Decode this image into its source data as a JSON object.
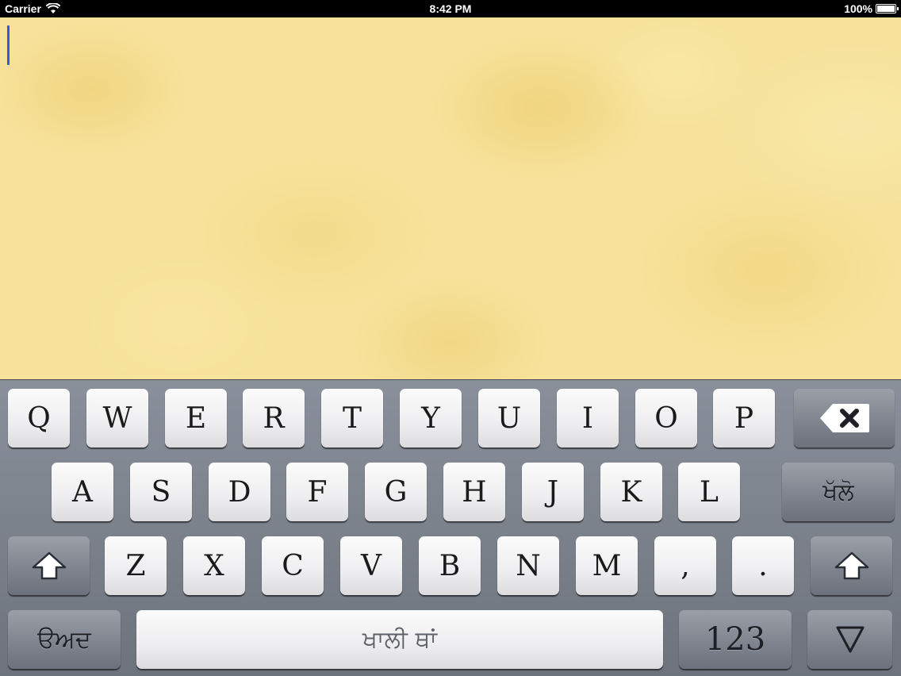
{
  "status_bar": {
    "carrier": "Carrier",
    "time": "8:42 PM",
    "battery": "100%"
  },
  "keyboard": {
    "row1": [
      "Q",
      "W",
      "E",
      "R",
      "T",
      "Y",
      "U",
      "I",
      "O",
      "P"
    ],
    "row2": [
      "A",
      "S",
      "D",
      "F",
      "G",
      "H",
      "J",
      "K",
      "L"
    ],
    "row3": [
      "Z",
      "X",
      "C",
      "V",
      "B",
      "N",
      "M",
      ",",
      "."
    ],
    "return_label": "ਖੱਲੋ",
    "mode_label": "ੳਅਦ",
    "space_label": "ਖਾਲੀ ਥਾਂ",
    "numbers_label": "123",
    "icons": {
      "delete": "backspace-icon",
      "shift": "shift-arrow-icon",
      "dismiss": "keyboard-dismiss-icon"
    }
  },
  "colors": {
    "text_area_background": "#f6e29a",
    "cursor": "#3a55d8",
    "keyboard_background": "#7f858f",
    "key_light": "#f2f2f4",
    "key_dark": "#7d828c"
  }
}
